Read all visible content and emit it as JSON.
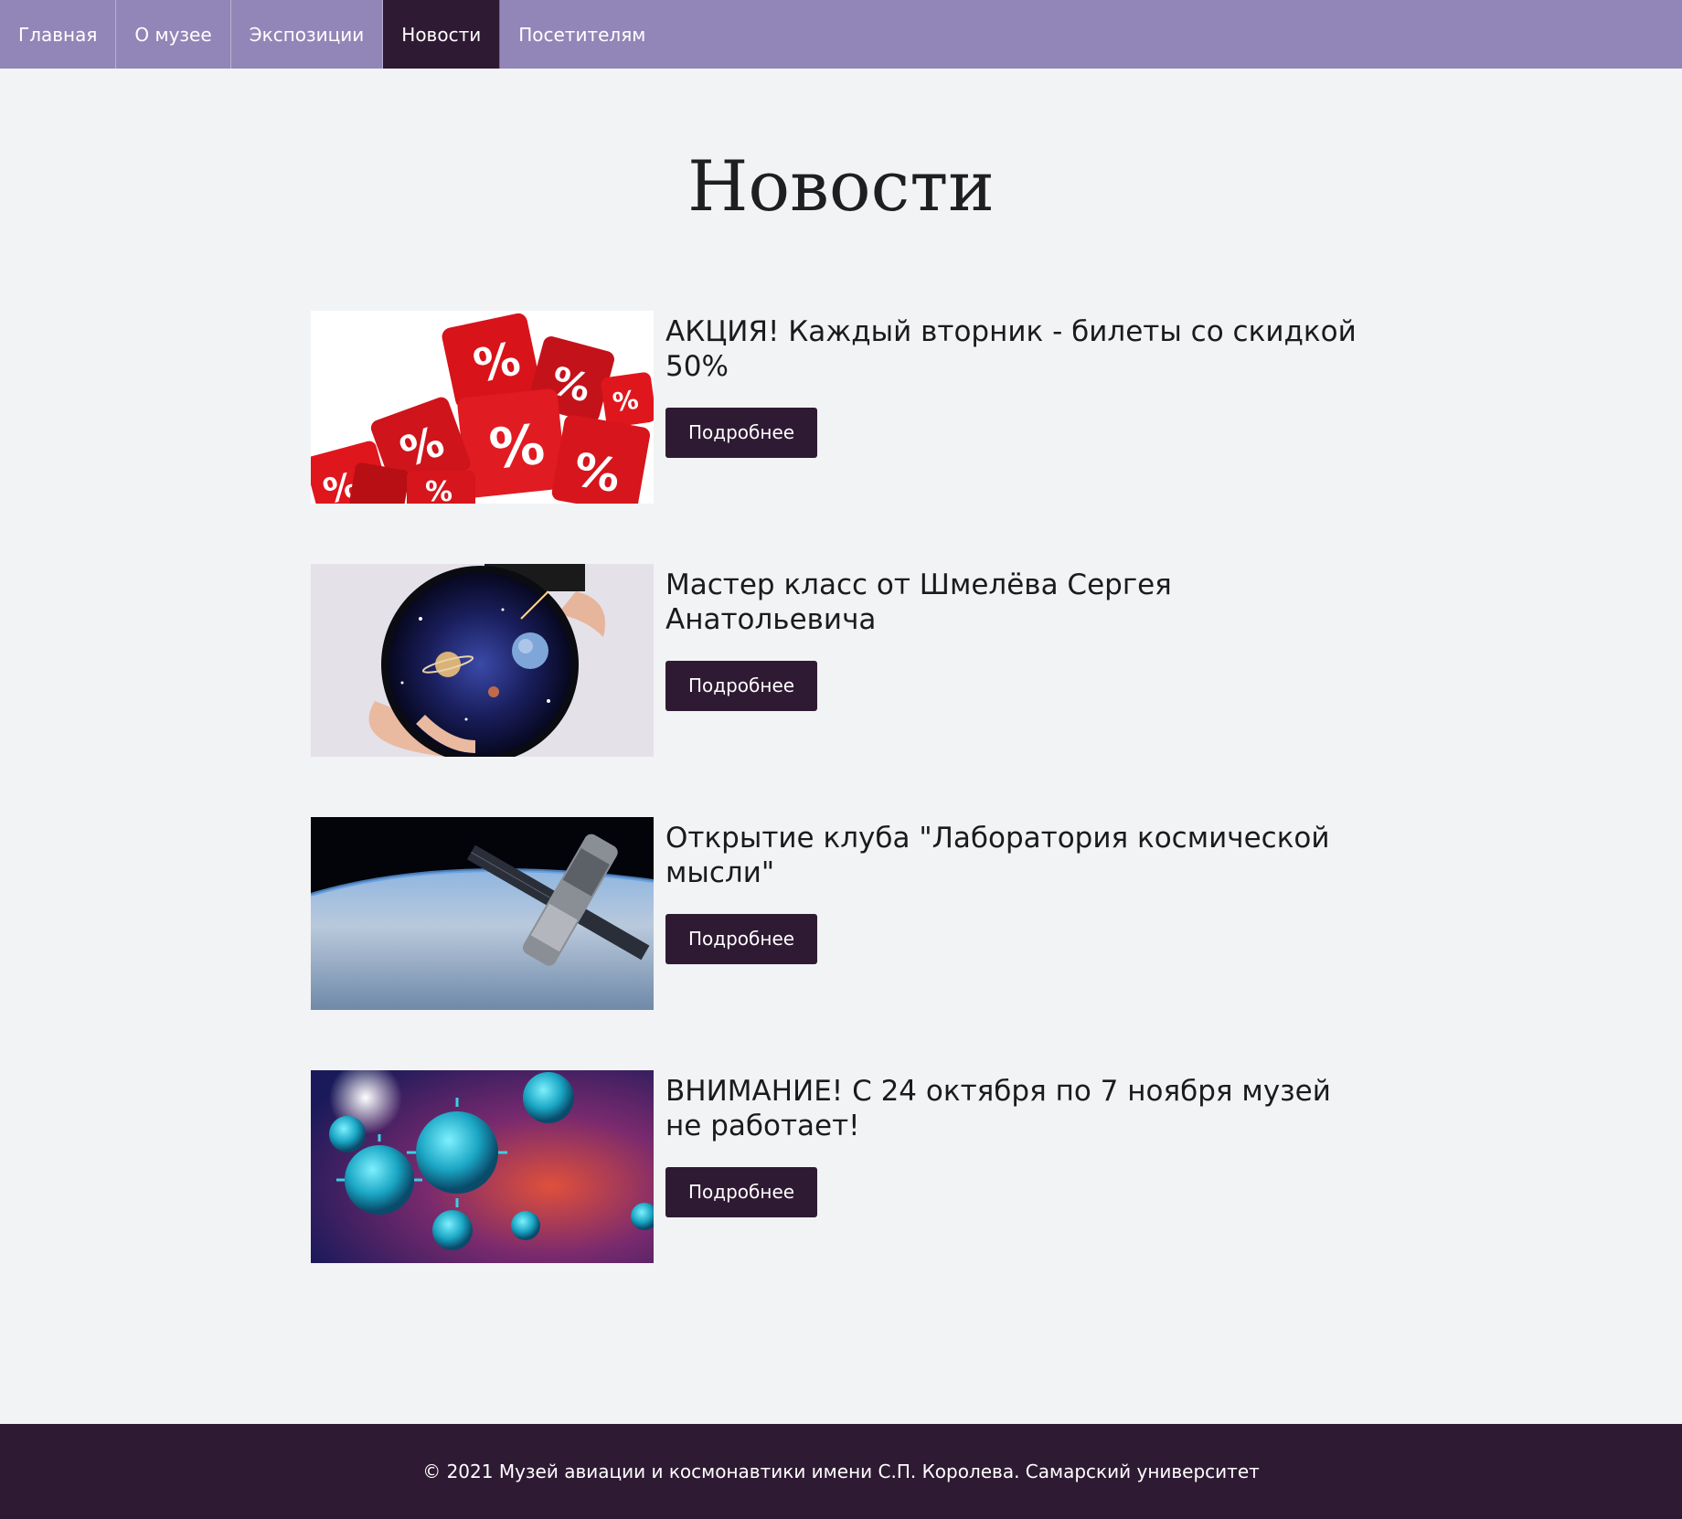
{
  "nav": {
    "items": [
      {
        "label": "Главная"
      },
      {
        "label": "О музее"
      },
      {
        "label": "Экспозиции"
      },
      {
        "label": "Новости"
      },
      {
        "label": "Посетителям"
      }
    ],
    "active_label": "Новости"
  },
  "page": {
    "title": "Новости"
  },
  "news": [
    {
      "title": "АКЦИЯ! Каждый вторник - билеты со скидкой 50%",
      "button": "Подробнее",
      "image": "discount-dice-image"
    },
    {
      "title": "Мастер класс от Шмелёва Сергея Анатольевича",
      "button": "Подробнее",
      "image": "cosmos-bag-image"
    },
    {
      "title": "Открытие клуба \"Лаборатория космической мысли\"",
      "button": "Подробнее",
      "image": "satellite-earth-image"
    },
    {
      "title": "ВНИМАНИЕ! С 24 октября по 7 ноября музей не работает!",
      "button": "Подробнее",
      "image": "virus-image"
    }
  ],
  "colors": {
    "nav_bg": "#9286b8",
    "accent_dark": "#2f1a33",
    "page_bg": "#f2f3f5"
  },
  "footer": {
    "text": "© 2021 Музей авиации и космонавтики имени С.П. Королева. Самарский университет"
  }
}
